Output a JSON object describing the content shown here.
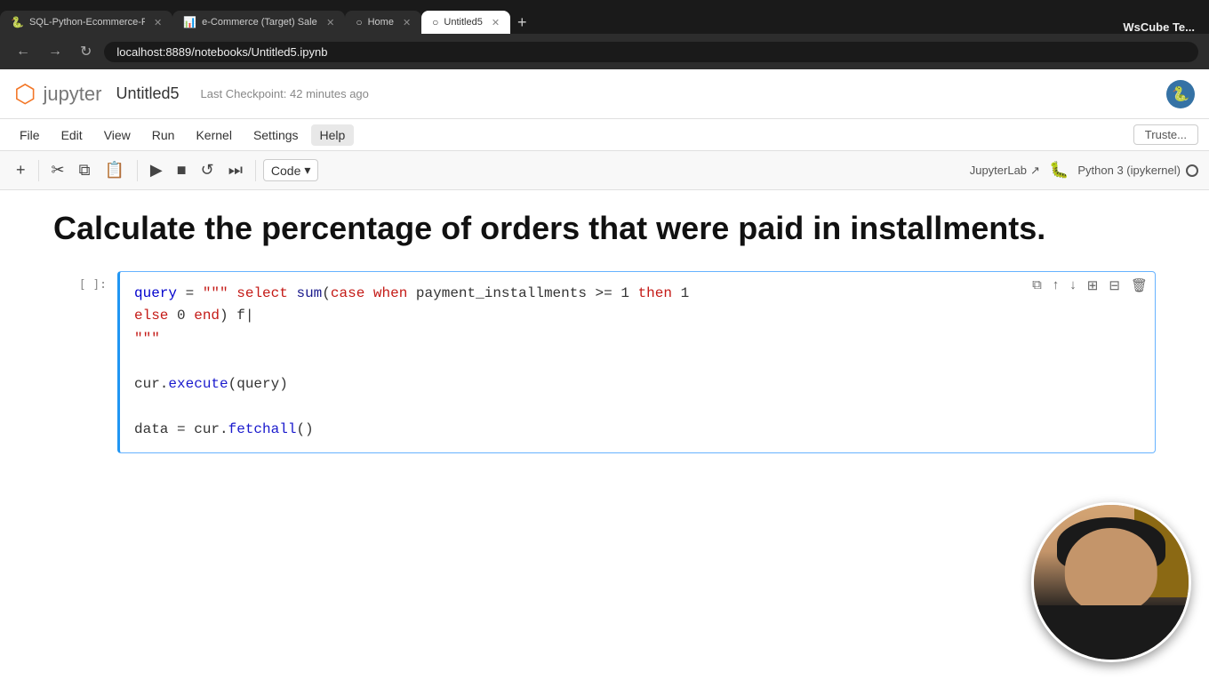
{
  "browser": {
    "tabs": [
      {
        "id": "tab1",
        "label": "SQL-Python-Ecommerce-Proj...",
        "favicon": "🐍",
        "active": false
      },
      {
        "id": "tab2",
        "label": "e-Commerce (Target) Sales Dat...",
        "favicon": "📊",
        "active": false
      },
      {
        "id": "tab3",
        "label": "Home",
        "favicon": "○",
        "active": false
      },
      {
        "id": "tab4",
        "label": "Untitled5",
        "favicon": "○",
        "active": true
      }
    ],
    "address": "localhost:8889/notebooks/Untitled5.ipynb",
    "wscube": "WsCube Te..."
  },
  "jupyter": {
    "logo_text": "jupyter",
    "title": "Untitled5",
    "checkpoint": "Last Checkpoint: 42 minutes ago",
    "menu": {
      "items": [
        "File",
        "Edit",
        "View",
        "Run",
        "Kernel",
        "Settings",
        "Help"
      ]
    },
    "toolbar": {
      "cell_type": "Code",
      "jupyterlab_label": "JupyterLab",
      "kernel_label": "Python 3 (ipykernel)"
    },
    "trusted": "Truste..."
  },
  "notebook": {
    "heading": "Calculate the percentage of orders that were paid in installments.",
    "cell": {
      "prompt": "[ ]:",
      "code_line1": "query = \"\"\" select sum(case when payment_installments >= 1 then 1",
      "code_line2": "else 0 end) f",
      "code_line3": "\"\"\"",
      "code_line4": "",
      "code_line5": "cur.execute(query)",
      "code_line6": "",
      "code_line7": "data = cur.fetchall()"
    }
  }
}
